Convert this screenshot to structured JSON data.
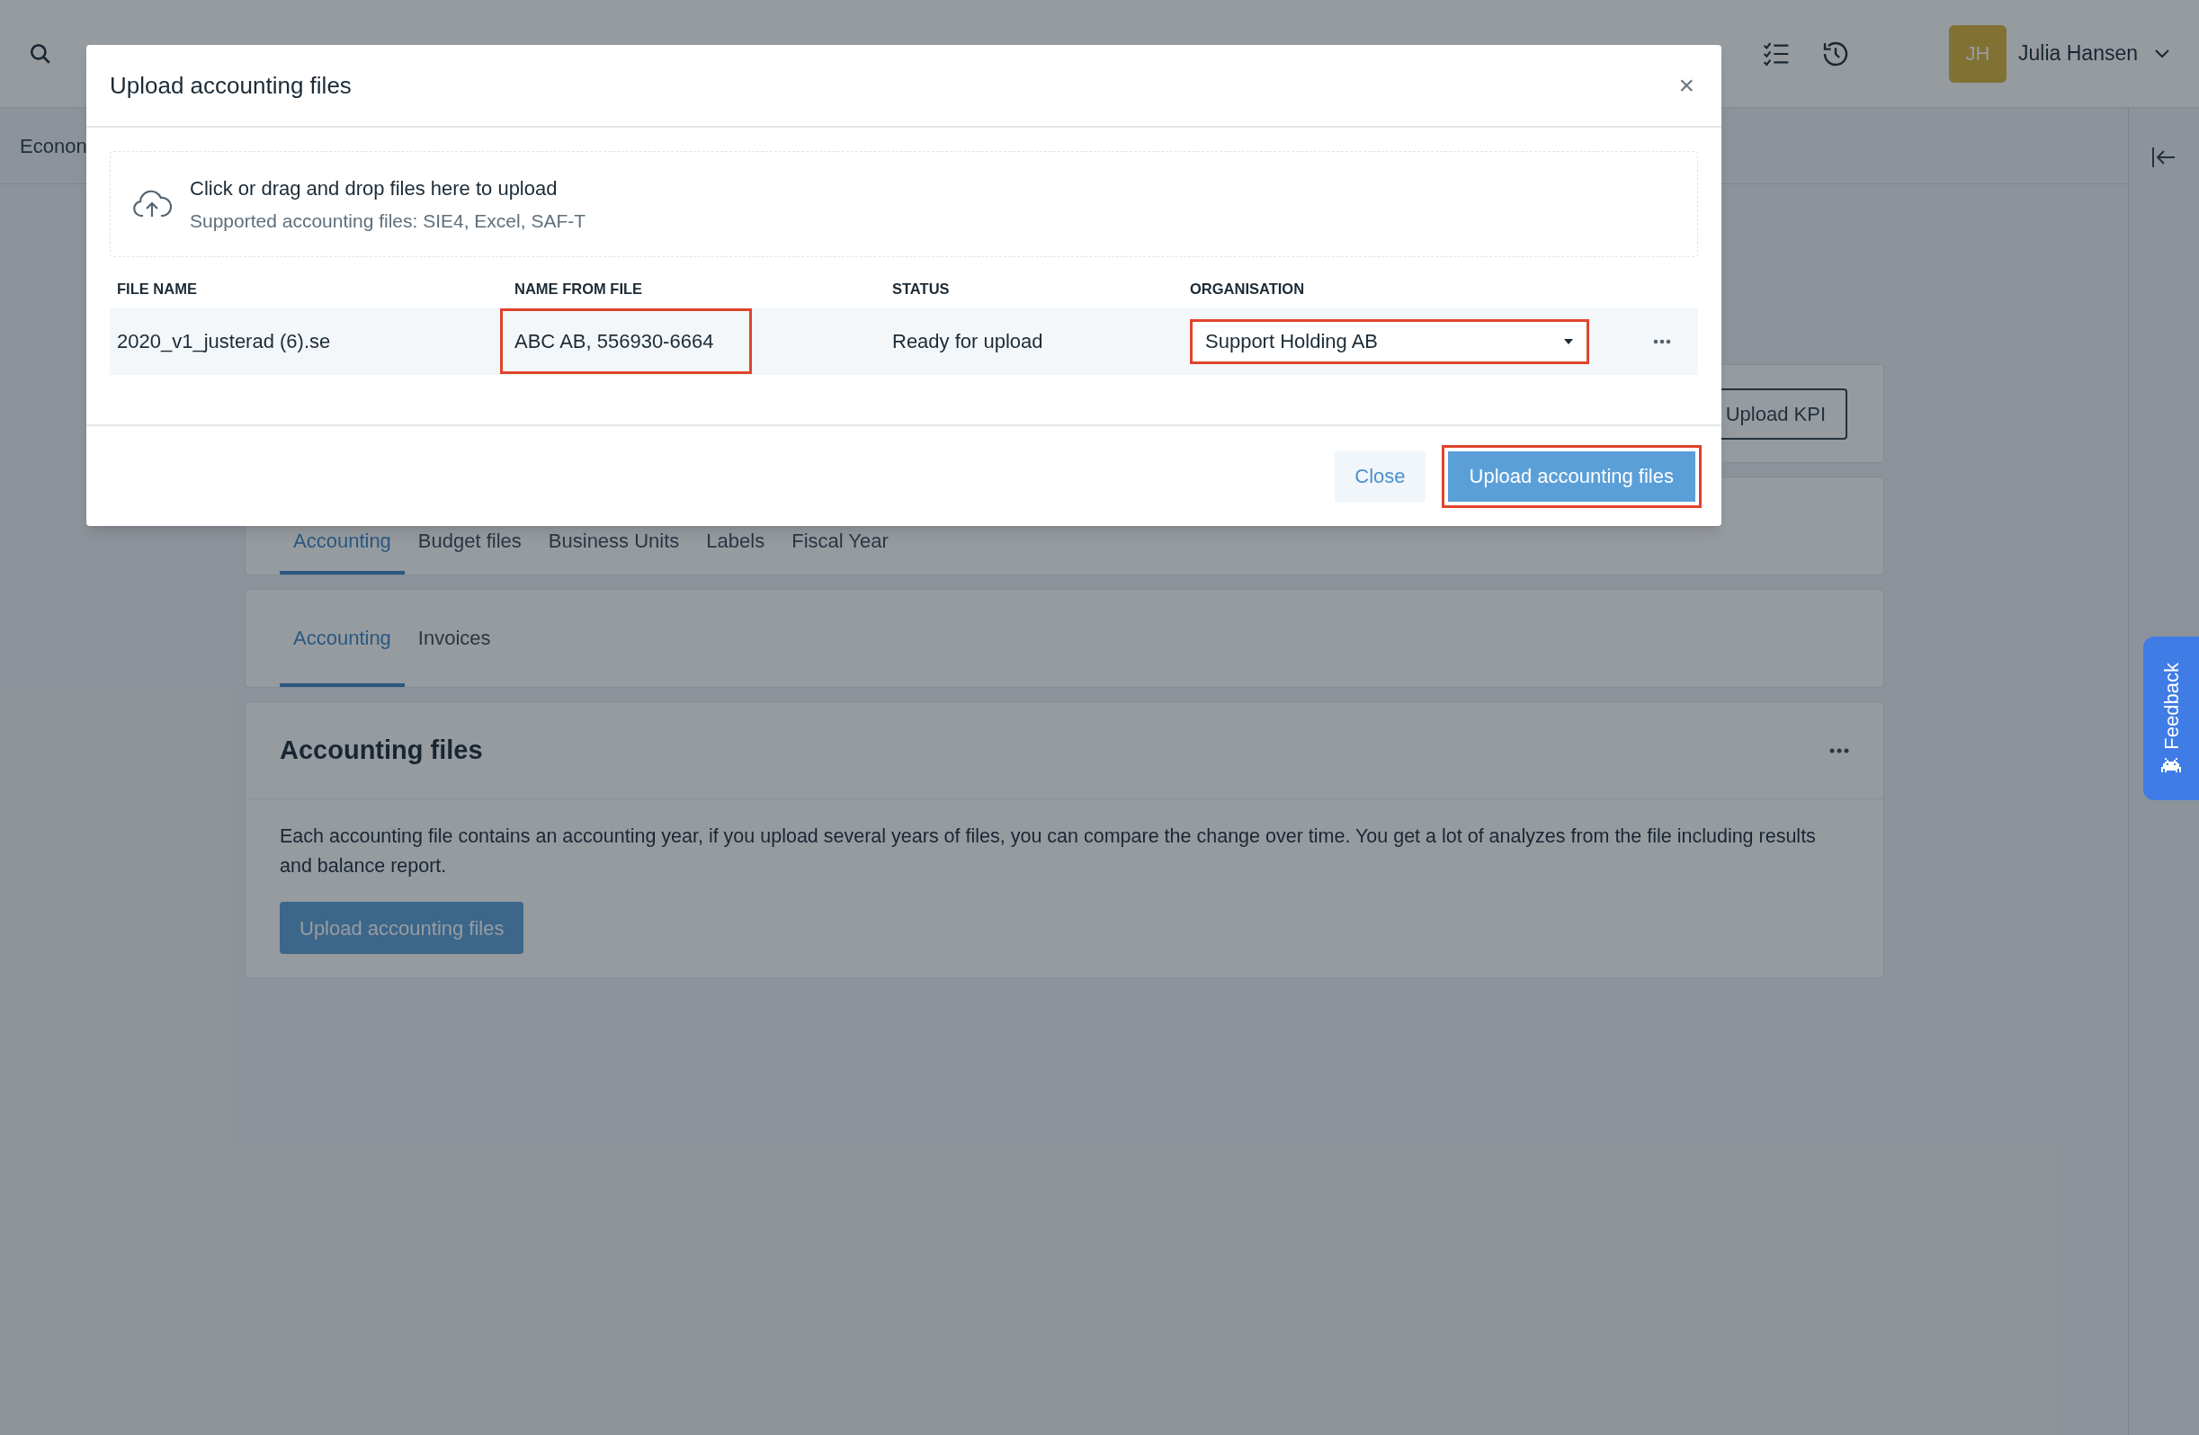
{
  "top_bar": {
    "user": {
      "initials": "JH",
      "name": "Julia Hansen"
    }
  },
  "breadcrumb": "Econon",
  "content": {
    "kpi_button": "Upload KPI",
    "main_tabs": [
      {
        "label": "Accounting",
        "selected": true
      },
      {
        "label": "Budget files",
        "selected": false
      },
      {
        "label": "Business Units",
        "selected": false
      },
      {
        "label": "Labels",
        "selected": false
      },
      {
        "label": "Fiscal Year",
        "selected": false
      }
    ],
    "sub_tabs": [
      {
        "label": "Accounting",
        "selected": true
      },
      {
        "label": "Invoices",
        "selected": false
      }
    ],
    "section": {
      "title": "Accounting files",
      "description": "Each accounting file contains an accounting year, if you upload several years of files, you can compare the change over time. You get a lot of analyzes from the file including results and balance report.",
      "button": "Upload accounting files"
    }
  },
  "feedback": "Feedback",
  "modal": {
    "title": "Upload accounting files",
    "close": "×",
    "dropzone": {
      "text": "Click or drag and drop files here to upload",
      "hint": "Supported accounting files: SIE4, Excel, SAF-T"
    },
    "columns": [
      "FILE NAME",
      "NAME FROM FILE",
      "STATUS",
      "ORGANISATION"
    ],
    "rows": [
      {
        "file_name": "2020_v1_justerad (6).se",
        "name_from_file": {
          "text": "ABC AB, 556930-6664",
          "highlighted": true
        },
        "status": "Ready for upload",
        "organisation": {
          "value": "Support Holding AB",
          "highlighted": true
        }
      }
    ],
    "buttons": [
      {
        "label": "Close",
        "kind": "secondary",
        "highlighted": false
      },
      {
        "label": "Upload accounting files",
        "kind": "primary",
        "highlighted": true
      }
    ]
  }
}
